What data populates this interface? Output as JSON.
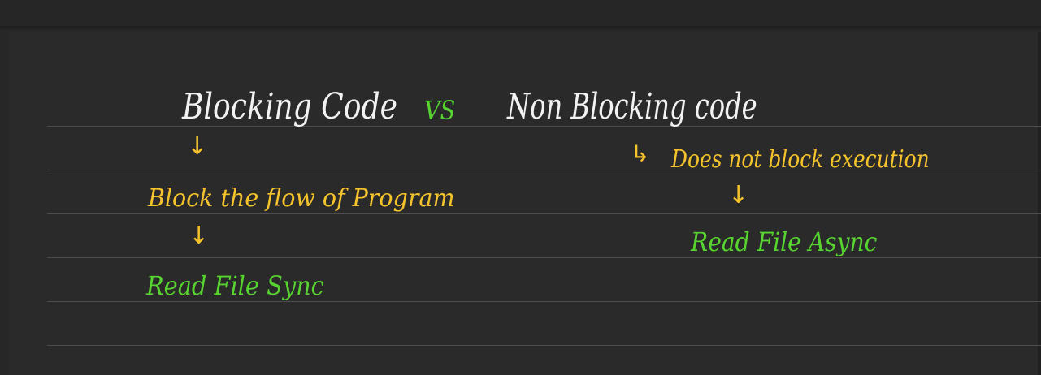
{
  "notes": {
    "heading_left": "Blocking Code",
    "heading_vs": "VS",
    "heading_right": "Non Blocking code",
    "left_arrow_1": "↓",
    "left_desc": "Block the flow of Program",
    "left_arrow_2": "↓",
    "left_example": "Read File Sync",
    "right_hook": "↳",
    "right_desc": "Does not block execution",
    "right_arrow": "↓",
    "right_example": "Read File Async"
  },
  "colors": {
    "background": "#2a2a2a",
    "heading": "#f2f2f2",
    "description": "#f5c32c",
    "example": "#57d42f",
    "rule": "#4d4d4d"
  }
}
